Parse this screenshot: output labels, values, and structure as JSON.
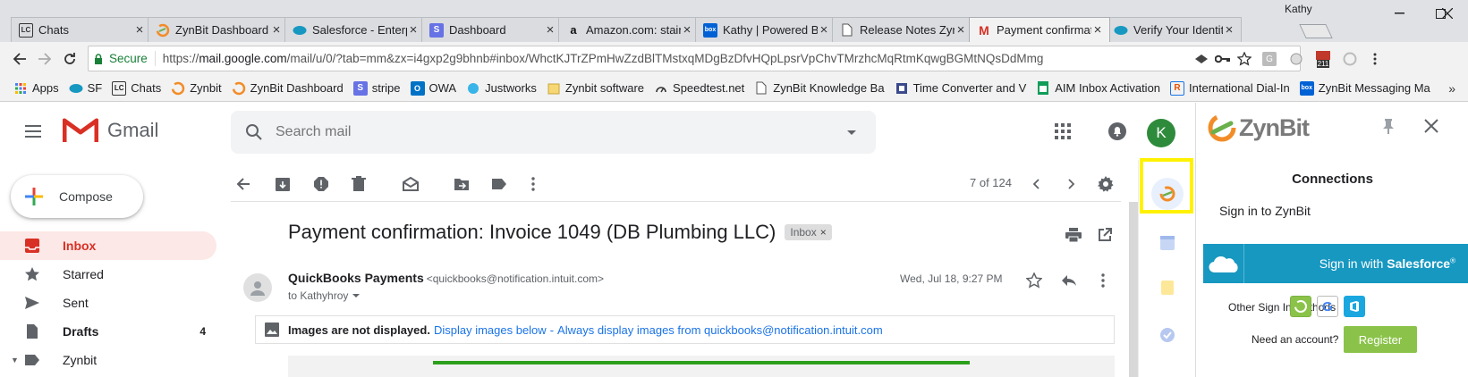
{
  "browser": {
    "user": "Kathy",
    "tabs": [
      {
        "title": "Chats",
        "icon": "lc-icon"
      },
      {
        "title": "ZynBit Dashboard",
        "icon": "zynbit-icon"
      },
      {
        "title": "Salesforce - Enterp",
        "icon": "salesforce-icon"
      },
      {
        "title": "Dashboard",
        "icon": "stripe-icon"
      },
      {
        "title": "Amazon.com: stain",
        "icon": "amazon-icon"
      },
      {
        "title": "Kathy | Powered By",
        "icon": "box-icon"
      },
      {
        "title": "Release Notes Zyn",
        "icon": "document-icon"
      },
      {
        "title": "Payment confirmat",
        "icon": "gmail-icon"
      },
      {
        "title": "Verify Your Identity",
        "icon": "salesforce-icon"
      }
    ],
    "secure_label": "Secure",
    "url_scheme": "https://",
    "url_host": "mail.google.com",
    "url_path": "/mail/u/0/?tab=mm&zx=i4gxp2g9bhnb#inbox/WhctKJTrZPmHwZzdBlTMstxqMDgBzDfvHQpLpsrVpChvTMrzhcMqRtmKqwgBGMtNQsDdMmg",
    "ext_badge": "211",
    "bookmarks": [
      "Apps",
      "SF",
      "Chats",
      "Zynbit",
      "ZynBit Dashboard",
      "stripe",
      "OWA",
      "Justworks",
      "Zynbit software",
      "Speedtest.net",
      "ZynBit Knowledge Ba",
      "Time Converter and V",
      "AIM Inbox Activation",
      "International Dial-In",
      "ZynBit Messaging Ma"
    ]
  },
  "gmail": {
    "logo_text": "Gmail",
    "search_placeholder": "Search mail",
    "avatar_letter": "K",
    "compose_label": "Compose",
    "nav": [
      {
        "label": "Inbox",
        "count": ""
      },
      {
        "label": "Starred",
        "count": ""
      },
      {
        "label": "Sent",
        "count": ""
      },
      {
        "label": "Drafts",
        "count": "4"
      },
      {
        "label": "Zynbit",
        "count": ""
      }
    ],
    "pager": "7 of 124",
    "subject": "Payment confirmation: Invoice 1049 (DB Plumbing LLC)",
    "label_chip": "Inbox",
    "sender_name": "QuickBooks Payments",
    "sender_email": "<quickbooks@notification.intuit.com>",
    "to_line": "to Kathyhroy",
    "date": "Wed, Jul 18, 9:27 PM",
    "images_notice": "Images are not displayed.",
    "display_below": "Display images below",
    "separator": "-",
    "always_display": "Always display images from quickbooks@notification.intuit.com"
  },
  "zynbit": {
    "logo_text": "ZynBit",
    "title": "Connections",
    "subtitle": "Sign in to ZynBit",
    "salesforce_button_prefix": "Sign in with ",
    "salesforce_button_brand": "Salesforce",
    "trademark": "®",
    "other_methods": "Other Sign In Methods",
    "need_account": "Need an account?",
    "register": "Register"
  },
  "colors": {
    "gmail_red": "#d93025",
    "highlight": "#fff200",
    "salesforce_blue": "#1798c1",
    "register_green": "#8bc34a",
    "avatar_green": "#2e8b3b"
  }
}
